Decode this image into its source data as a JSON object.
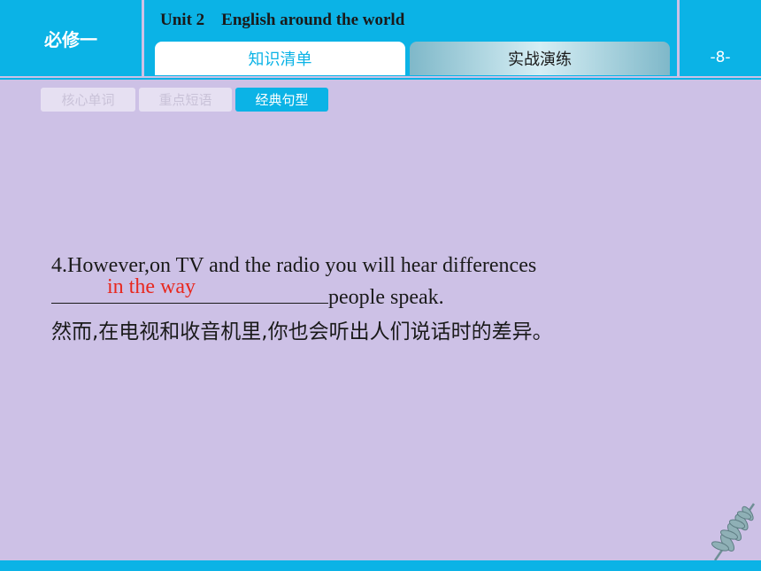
{
  "header": {
    "course": "必修一",
    "unit_title": "Unit 2    English around the world",
    "tabs": [
      {
        "label": "知识清单",
        "active": true
      },
      {
        "label": "实战演练",
        "active": false
      }
    ],
    "page_number": "-8-"
  },
  "subtabs": [
    {
      "label": "核心单词",
      "active": false
    },
    {
      "label": "重点短语",
      "active": false
    },
    {
      "label": "经典句型",
      "active": true
    }
  ],
  "exercise": {
    "line1": "4.However,on TV and the radio you will hear differences",
    "answer": "in the way",
    "after_blank": "people speak.",
    "translation": "然而,在电视和收音机里,你也会听出人们说话时的差异。"
  },
  "colors": {
    "accent": "#0bb3e6",
    "background": "#cdc1e6",
    "answer": "#e8281e"
  },
  "icons": {
    "decoration": "leaf-icon"
  }
}
